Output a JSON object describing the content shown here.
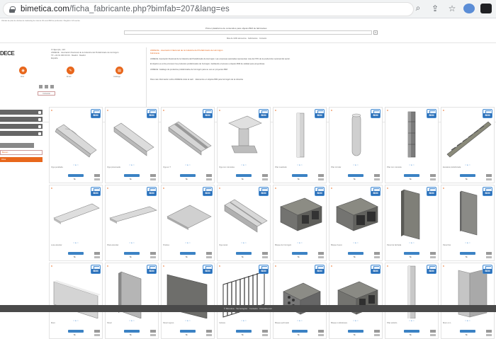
{
  "browser": {
    "url_domain": "bimetica.com",
    "url_path": "/ficha_fabricante.php?bimfab=207&lang=es"
  },
  "page": {
    "top_line_1": "Ofertas de plan de ofertas de marketing de más de 30 usos BIM de productos / Registro / Mi cuenta",
    "top_line_2": "",
    "tagline": "Primer plataforma de contenidos para objetos BIM de fabricantes",
    "search_placeholder": "Buscar",
    "search_btn": "»",
    "subnav": "Más de 1200 elementos · Fabricantes · Contacto"
  },
  "company": {
    "logo": "DECE",
    "info_lines": [
      "C/ Ejemplo, 123",
      "ANDECE · Asociación Nacional de la Industria del Prefabricado de Hormigón",
      "Tlf: +34 91 000 00 00 · Madrid · Madrid",
      "España"
    ],
    "actions": [
      {
        "label": "Web"
      },
      {
        "label": "Email"
      },
      {
        "label": "Catálogo"
      }
    ],
    "contact_button": "Contactar"
  },
  "description": {
    "title": "ANDECE - Asociación Nacional de la Industria del Prefabricado de Hormigón",
    "subtitle": "Fabricante",
    "lines": [
      "ANDECE: Asociación Nacional de la Industria del Prefabricado de Hormigón. Las empresas asociadas representan más del 70% de la producción nacional del sector.",
      "El objetivo es el de promover los productos prefabricados de hormigón, facilitando el acceso a objetos BIM de calidad para proyectistas.",
      "ANDECE: Catálogo de productos prefabricados de hormigón para su uso en proyectos BIM.",
      "Para más información sobre ANDECE visite la web: · Elementos en objetos BIM para hormigón de la industria"
    ]
  },
  "filters": [
    {
      "label": "Categoría"
    },
    {
      "label": "Subcategoría"
    },
    {
      "label": "Formato"
    },
    {
      "label": "Licencia"
    },
    {
      "label": ""
    },
    {
      "label": "Buscar..."
    },
    {
      "label": "Filtrar"
    }
  ],
  "cards": [
    {
      "tag": "B",
      "name": "Viga peraltada",
      "shape": "ramp-beam"
    },
    {
      "tag": "B",
      "name": "Viga pretensada",
      "shape": "beam"
    },
    {
      "tag": "B",
      "name": "Viga en T",
      "shape": "beam-t"
    },
    {
      "tag": "B",
      "name": "Viga con ménsulas",
      "shape": "ibeam"
    },
    {
      "tag": "B",
      "name": "Pilar cuadrado",
      "shape": "column-sq"
    },
    {
      "tag": "B",
      "name": "Pilar circular",
      "shape": "column-round"
    },
    {
      "tag": "B",
      "name": "Pilar con ménsula",
      "shape": "column-stack"
    },
    {
      "tag": "B",
      "name": "Escalera prefabricada",
      "shape": "stairs"
    },
    {
      "tag": "B",
      "name": "Losa alveolar",
      "shape": "slab-hollow"
    },
    {
      "tag": "B",
      "name": "Placa alveolar",
      "shape": "slab-hollow2"
    },
    {
      "tag": "B",
      "name": "Prelosa",
      "shape": "plate"
    },
    {
      "tag": "B",
      "name": "Viga canal",
      "shape": "channel"
    },
    {
      "tag": "B",
      "name": "Bloque de hormigón",
      "shape": "block"
    },
    {
      "tag": "B",
      "name": "Bloque hueco",
      "shape": "block2"
    },
    {
      "tag": "B",
      "name": "Panel de fachada",
      "shape": "panel"
    },
    {
      "tag": "B",
      "name": "Panel liso",
      "shape": "panel-thin"
    },
    {
      "tag": "B",
      "name": "Muro",
      "shape": "wall-slant"
    },
    {
      "tag": "B",
      "name": "Panel",
      "shape": "panel-b"
    },
    {
      "tag": "B",
      "name": "Panel rugoso",
      "shape": "panel-dark"
    },
    {
      "tag": "B",
      "name": "Celosía",
      "shape": "grille"
    },
    {
      "tag": "B",
      "name": "Bloque perforado",
      "shape": "block-holes"
    },
    {
      "tag": "B",
      "name": "Bloque multicámara",
      "shape": "block3"
    },
    {
      "tag": "B",
      "name": "Pilar esbelto",
      "shape": "column-slim"
    },
    {
      "tag": "B",
      "name": "Muro en L",
      "shape": "lwall"
    }
  ],
  "card_common": {
    "bim_badge": "BIM",
    "rating": "☆ ★ ☆",
    "size_label": "5k"
  },
  "footer": "© Bimetica · Tecnologías · Contacto · bimetica.com",
  "colors": {
    "accent": "#e8671c",
    "bim_blue": "#2a6fb8"
  }
}
